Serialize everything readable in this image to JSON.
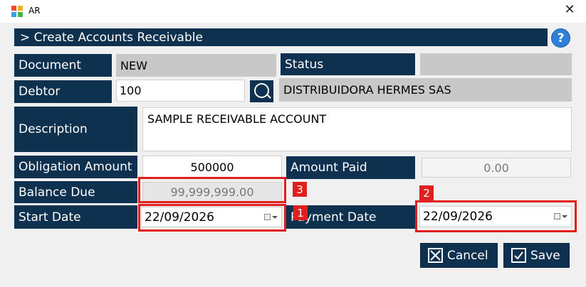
{
  "window": {
    "title": "AR",
    "close_glyph": "✕"
  },
  "header": {
    "title": "> Create Accounts Receivable",
    "help_glyph": "?"
  },
  "fields": {
    "document_label": "Document",
    "document_value": "NEW",
    "status_label": "Status",
    "status_value": "",
    "debtor_label": "Debtor",
    "debtor_value": "100",
    "debtor_name": "DISTRIBUIDORA HERMES SAS",
    "description_label": "Description",
    "description_value": "SAMPLE RECEIVABLE ACCOUNT",
    "obligation_label": "Obligation Amount",
    "obligation_value": "500000",
    "amount_paid_label": "Amount Paid",
    "amount_paid_value": "0.00",
    "balance_label": "Balance Due",
    "balance_value": "99,999,999.00",
    "start_date_label": "Start Date",
    "start_date_value": "22/09/2026",
    "payment_date_label": "Payment Date",
    "payment_date_value": "22/09/2026"
  },
  "annotations": {
    "badge1": "1",
    "badge2": "2",
    "badge3": "3"
  },
  "buttons": {
    "cancel": "Cancel",
    "save": "Save"
  },
  "icons": {
    "app": "app-logo-icon",
    "search": "search-icon",
    "calendar": "calendar-dropdown-icon"
  },
  "colors": {
    "navy": "#0e3150",
    "field_gray": "#c8c8c8",
    "highlight_red": "#e0201e",
    "help_blue": "#2f7fd6"
  }
}
